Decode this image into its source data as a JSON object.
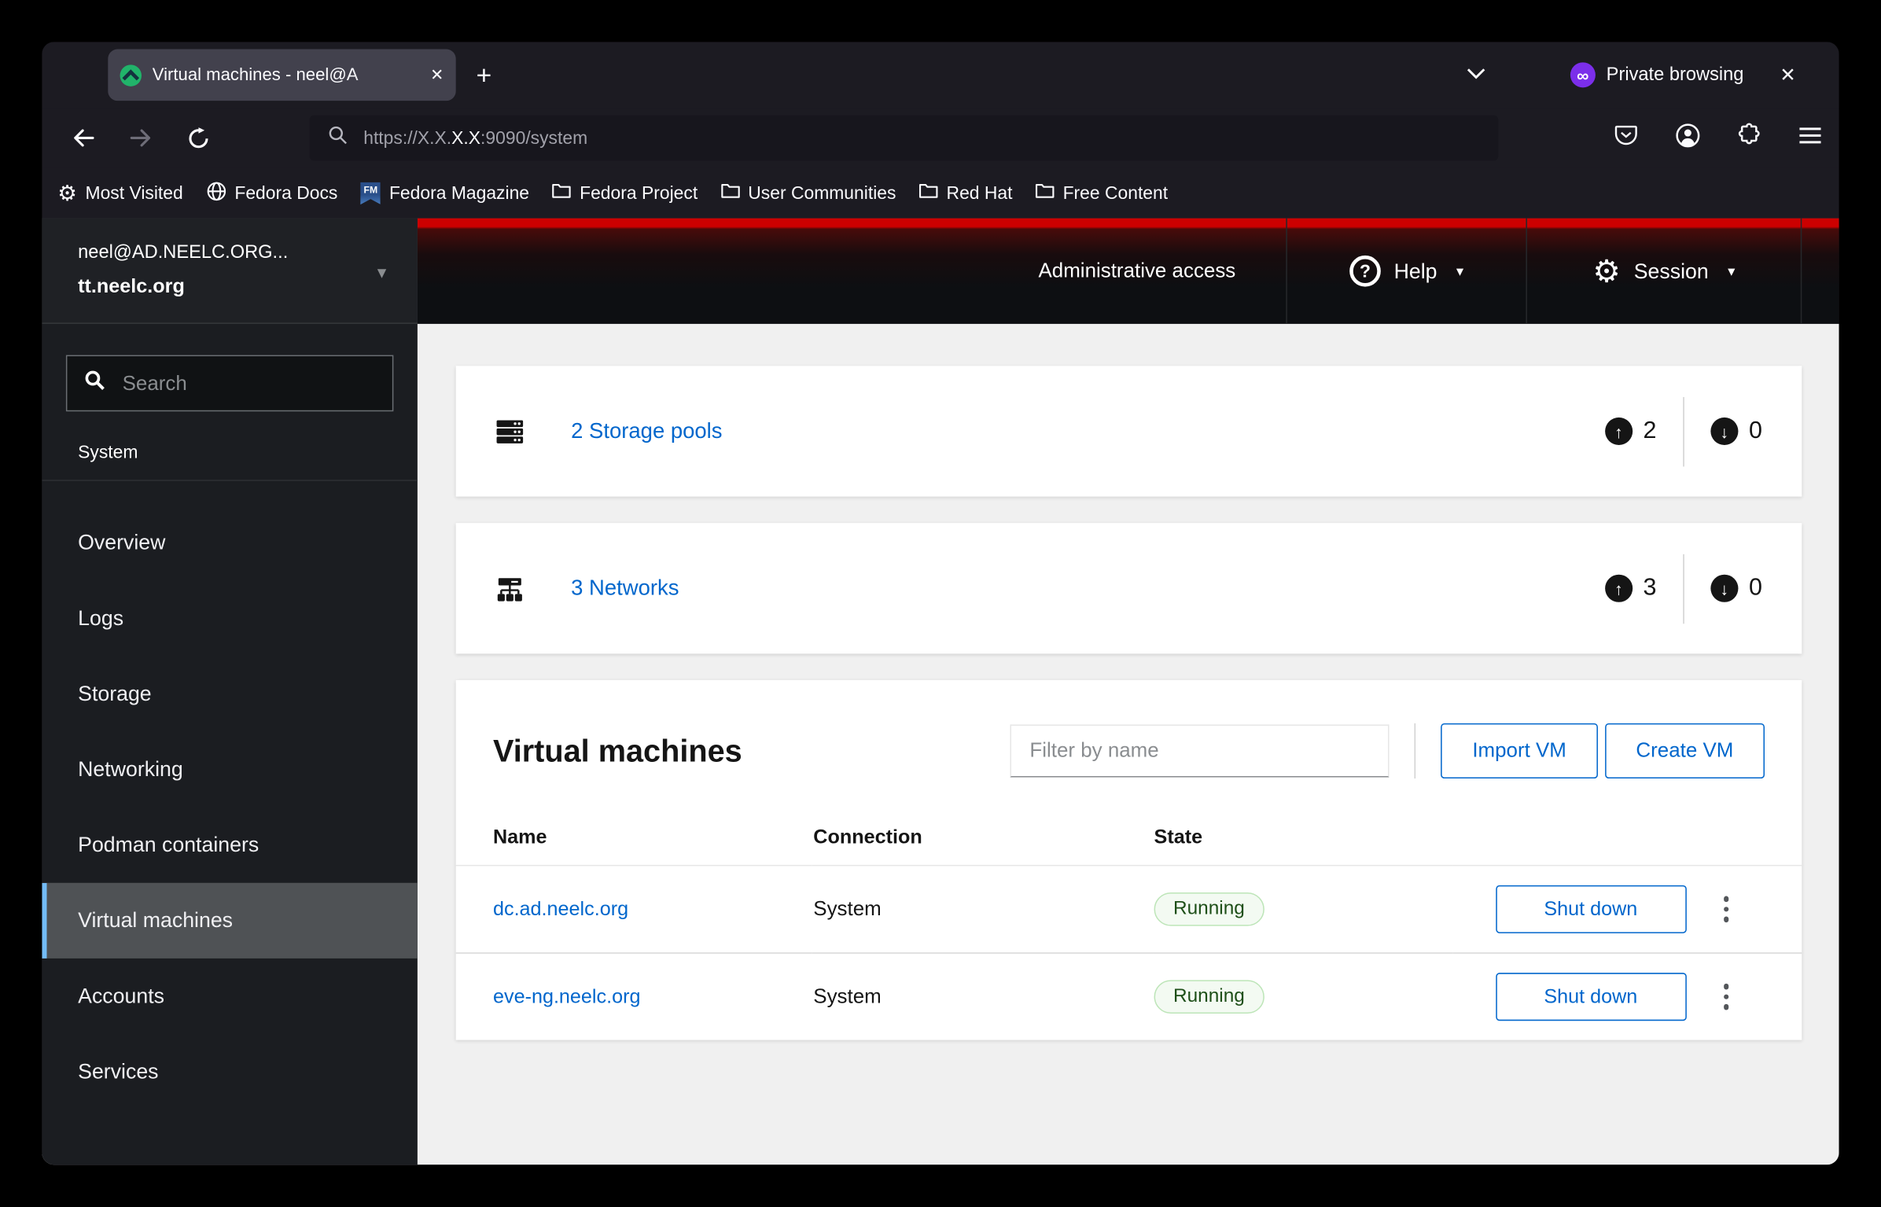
{
  "glyphs": {
    "close_x": "✕",
    "plus": "+",
    "caret_down": "▾",
    "up_arrow": "↑",
    "down_arrow": "↓",
    "mask_infinity": "∞",
    "question_mark": "?",
    "gear": "⚙"
  },
  "browser": {
    "tab": {
      "title": "Virtual machines - neel@A"
    },
    "private_label": "Private browsing",
    "url": {
      "scheme_host_dim": "https://X.X.",
      "host_highlight": "X.X",
      "path_dim": ":9090/system"
    },
    "bookmarks": [
      {
        "label": "Most Visited",
        "icon": "gear"
      },
      {
        "label": "Fedora Docs",
        "icon": "globe"
      },
      {
        "label": "Fedora Magazine",
        "icon": "fm-badge",
        "badge_text": "FM"
      },
      {
        "label": "Fedora Project",
        "icon": "folder"
      },
      {
        "label": "User Communities",
        "icon": "folder"
      },
      {
        "label": "Red Hat",
        "icon": "folder"
      },
      {
        "label": "Free Content",
        "icon": "folder"
      }
    ]
  },
  "sidebar": {
    "user": "neel@AD.NEELC.ORG...",
    "host": "tt.neelc.org",
    "search_placeholder": "Search",
    "section_label": "System",
    "items": [
      {
        "label": "Overview",
        "active": false
      },
      {
        "label": "Logs",
        "active": false
      },
      {
        "label": "Storage",
        "active": false
      },
      {
        "label": "Networking",
        "active": false
      },
      {
        "label": "Podman containers",
        "active": false
      },
      {
        "label": "Virtual machines",
        "active": true
      },
      {
        "label": "Accounts",
        "active": false
      },
      {
        "label": "Services",
        "active": false
      }
    ]
  },
  "masthead": {
    "admin_access": "Administrative access",
    "help_label": "Help",
    "session_label": "Session"
  },
  "cards": [
    {
      "icon": "storage-pools",
      "link_label": "2 Storage pools",
      "up_count": "2",
      "down_count": "0"
    },
    {
      "icon": "networks",
      "link_label": "3 Networks",
      "up_count": "3",
      "down_count": "0"
    }
  ],
  "vm_panel": {
    "title": "Virtual machines",
    "filter_placeholder": "Filter by name",
    "import_label": "Import VM",
    "create_label": "Create VM",
    "columns": [
      "Name",
      "Connection",
      "State"
    ],
    "rows": [
      {
        "name": "dc.ad.neelc.org",
        "connection": "System",
        "state": "Running",
        "action": "Shut down"
      },
      {
        "name": "eve-ng.neelc.org",
        "connection": "System",
        "state": "Running",
        "action": "Shut down"
      }
    ]
  },
  "colors": {
    "accent_blue": "#0066cc",
    "selected_indicator": "#73bcf7",
    "running_text": "#1e4f18",
    "running_bg": "#f3faf2",
    "running_border": "#bde5b8",
    "private_purple": "#7b2eea",
    "masthead_red": "#cc0000",
    "cockpit_green": "#21b36a",
    "fedora_blue": "#3c6eb4",
    "chrome_dark": "#1c1b22",
    "sidebar_dark": "#1b1d21"
  }
}
